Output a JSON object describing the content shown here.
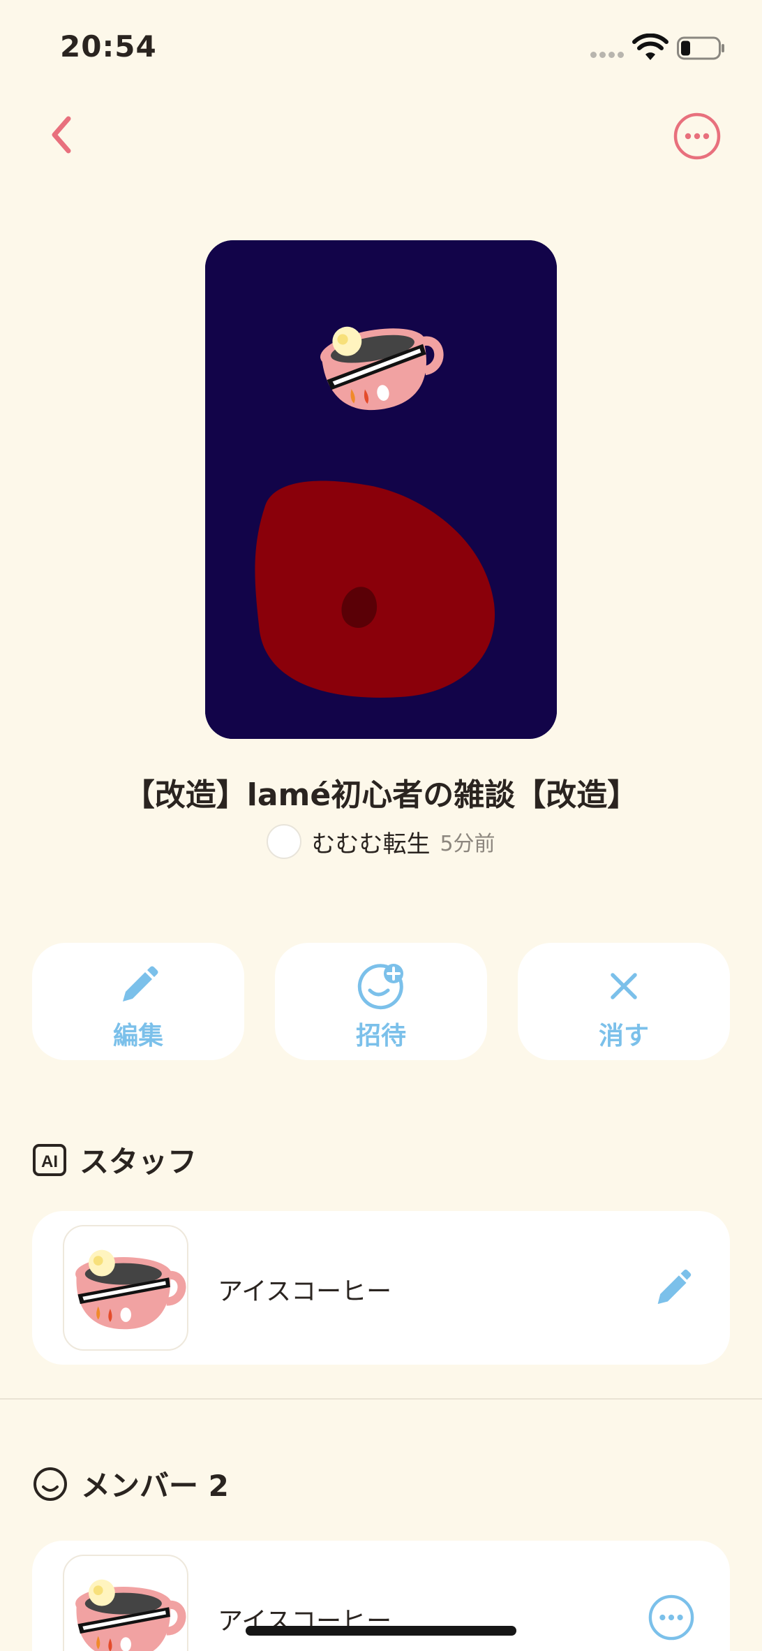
{
  "status_bar": {
    "time": "20:54"
  },
  "room": {
    "title": "【改造】lamé初心者の雑談【改造】",
    "owner_name": "むむむ転生",
    "posted_time": "5分前"
  },
  "actions": {
    "edit_label": "編集",
    "invite_label": "招待",
    "delete_label": "消す"
  },
  "staff_section": {
    "title": "スタッフ",
    "badge": "AI",
    "items": [
      {
        "name": "アイスコーヒー"
      }
    ]
  },
  "members_section": {
    "title": "メンバー 2",
    "items": [
      {
        "name": "アイスコーヒー"
      }
    ]
  },
  "colors": {
    "accent_pink": "#e8707d",
    "action_blue": "#7bc0ea",
    "background": "#fdf8ea",
    "cover_bg": "#120449"
  }
}
